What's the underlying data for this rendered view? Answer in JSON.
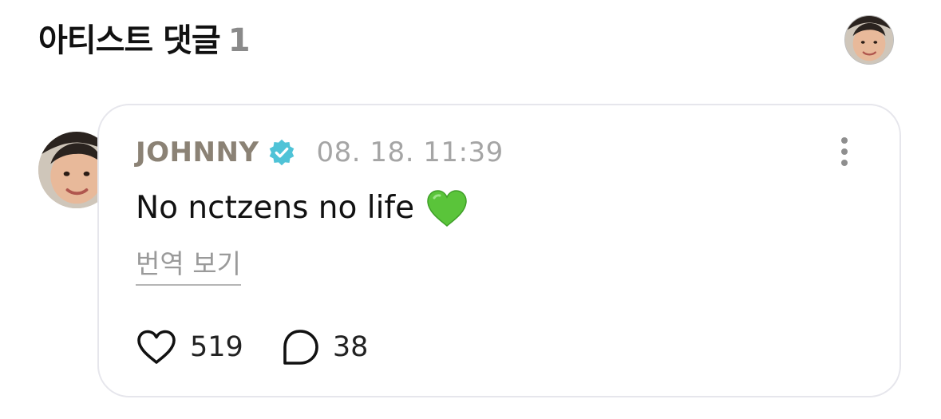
{
  "header": {
    "title": "아티스트 댓글",
    "count": "1"
  },
  "comment": {
    "author": "JOHNNY",
    "timestamp": "08. 18. 11:39",
    "text": "No nctzens no life",
    "emoji": "green-heart",
    "translate_label": "번역 보기",
    "likes": "519",
    "replies": "38"
  },
  "colors": {
    "author": "#8b8275",
    "verified_badge": "#4fc3d7",
    "green_heart": "#5ac43a",
    "card_border": "#e6e6ec"
  }
}
